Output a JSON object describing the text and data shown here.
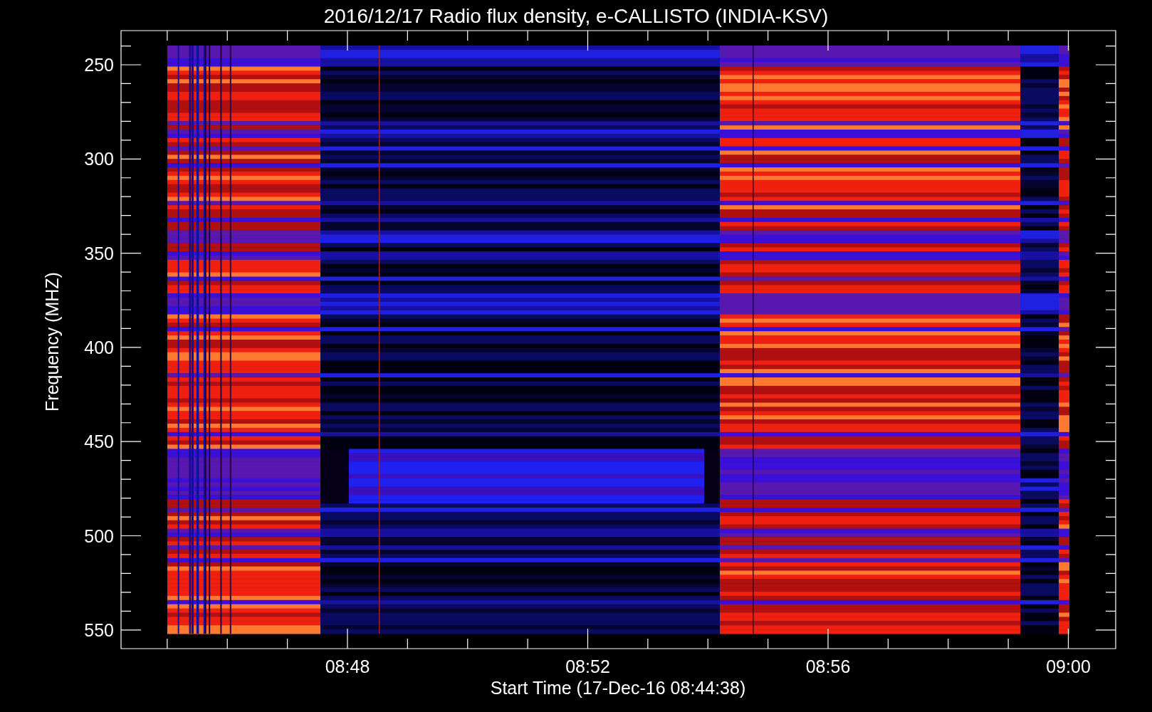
{
  "title": "2016/12/17  Radio flux density, e-CALLISTO (INDIA-KSV)",
  "y_axis": {
    "label": "Frequency (MHZ)",
    "ticks": [
      "250",
      "300",
      "350",
      "400",
      "450",
      "500",
      "550"
    ]
  },
  "x_axis": {
    "label": "Start Time (17-Dec-16 08:44:38)",
    "ticks": [
      "08:48",
      "08:52",
      "08:56",
      "09:00"
    ]
  }
}
